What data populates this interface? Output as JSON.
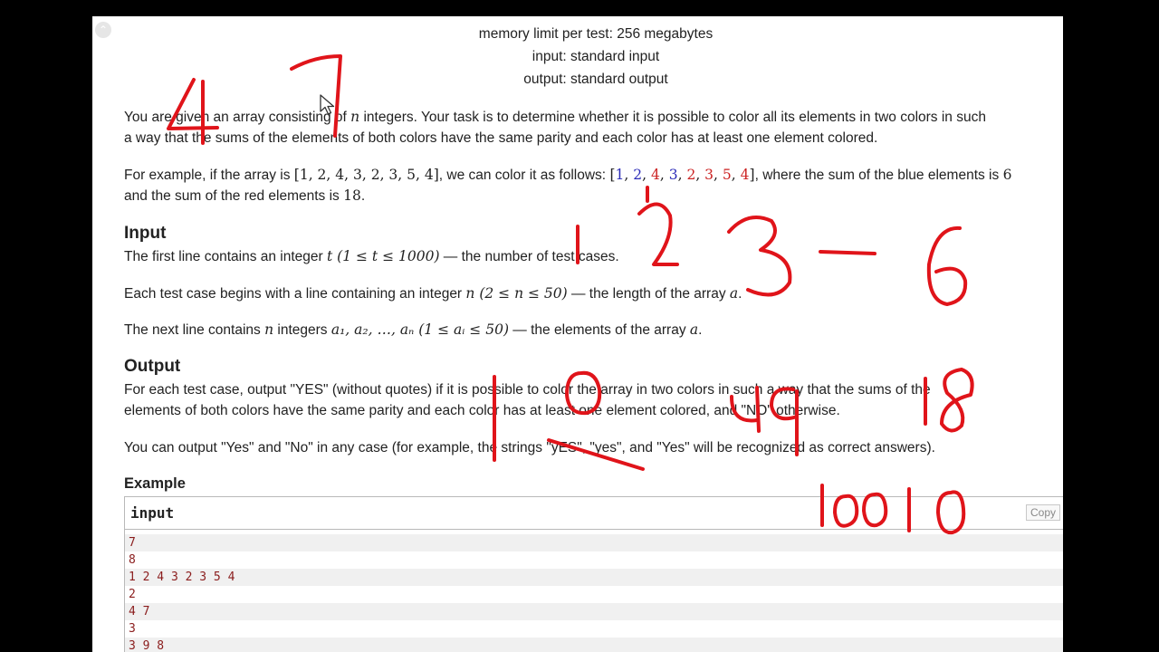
{
  "header": {
    "memory_limit": "memory limit per test: 256 megabytes",
    "input_file": "input: standard input",
    "output_file": "output: standard output"
  },
  "statement": {
    "p1_a": "You are given an array consisting of ",
    "p1_var": "n",
    "p1_b": " integers. Your task is to determine whether it is possible to color all its elements in two colors in such",
    "p1_line2": "a way that the sums of the elements of both colors have the same parity and each color has at least one element colored.",
    "p2_a": "For example, if the array is ",
    "p2_array": "[1, 2, 4, 3, 2, 3, 5, 4]",
    "p2_b": ", we can color it as follows: ",
    "p2_colored_open": "[",
    "p2_colored": [
      {
        "v": "1",
        "c": "blue"
      },
      {
        "v": "2",
        "c": "blue"
      },
      {
        "v": "4",
        "c": "red"
      },
      {
        "v": "3",
        "c": "blue"
      },
      {
        "v": "2",
        "c": "red"
      },
      {
        "v": "3",
        "c": "red"
      },
      {
        "v": "5",
        "c": "red"
      },
      {
        "v": "4",
        "c": "red"
      }
    ],
    "p2_colored_close": "]",
    "p2_c": ", where the sum of the blue elements is ",
    "p2_blue_sum": "6",
    "p2_line2_a": "and the sum of the red elements is ",
    "p2_red_sum": "18",
    "p2_line2_b": "."
  },
  "input_section": {
    "title": "Input",
    "l1_a": "The first line contains an integer ",
    "l1_math": "t (1 ≤ t ≤ 1000)",
    "l1_b": " — the number of test cases.",
    "l2_a": "Each test case begins with a line containing an integer ",
    "l2_math": "n (2 ≤ n ≤ 50)",
    "l2_b": " — the length of the array ",
    "l2_var": "a",
    "l2_c": ".",
    "l3_a": "The next line contains ",
    "l3_var": "n",
    "l3_b": " integers ",
    "l3_math": "a₁, a₂, …, aₙ (1 ≤ aᵢ ≤ 50)",
    "l3_c": " — the elements of the array ",
    "l3_var2": "a",
    "l3_d": "."
  },
  "output_section": {
    "title": "Output",
    "l1": "For each test case, output \"YES\" (without quotes) if it is possible to color the array in two colors in such a way that the sums of the",
    "l2": "elements of both colors have the same parity and each color has at least one element colored, and \"NO\" otherwise.",
    "l3": "You can output \"Yes\" and \"No\" in any case (for example, the strings \"yES\", \"yes\", and \"Yes\" will be recognized as correct answers)."
  },
  "example": {
    "title": "Example",
    "input_label": "input",
    "copy_label": "Copy",
    "lines": [
      "7",
      "8",
      "1 2 4 3 2 3 5 4",
      "2",
      "4 7",
      "3",
      "3 9 8"
    ]
  },
  "colors": {
    "ink_red": "#e0141a",
    "math_blue": "#2c2cb8",
    "math_red": "#cc2222",
    "sample_text": "#8a1c1c"
  }
}
